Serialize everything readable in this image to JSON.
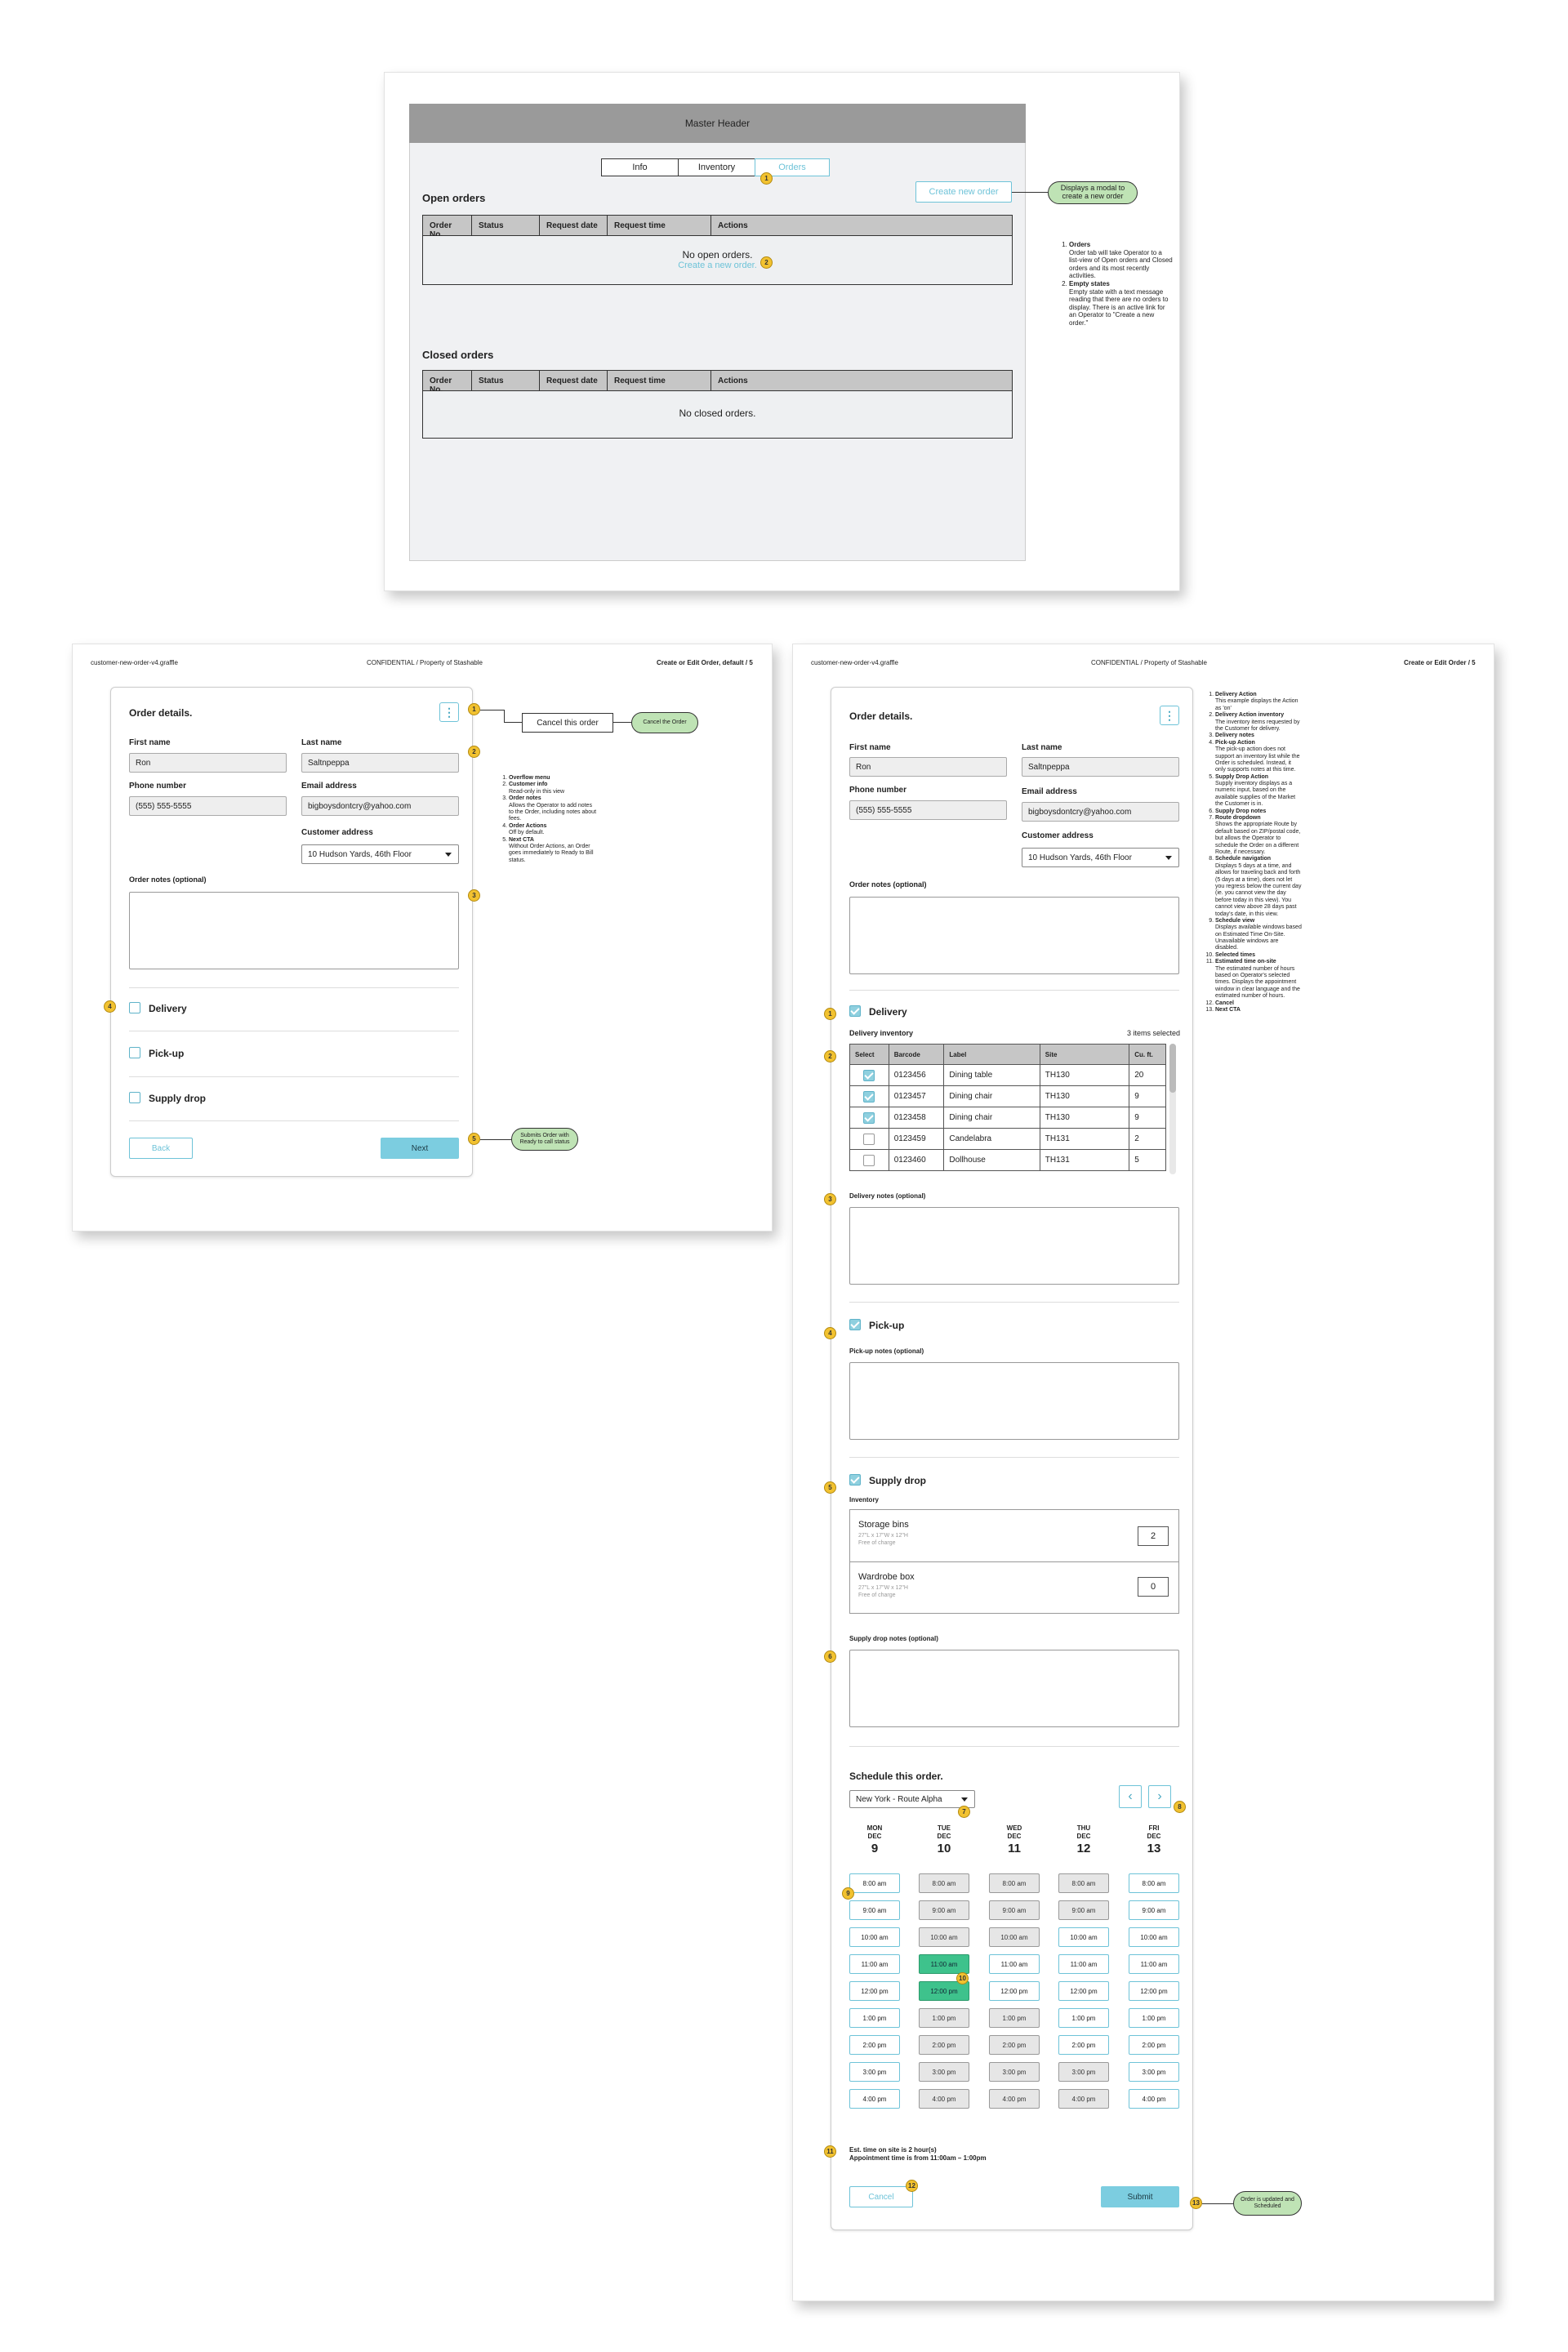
{
  "top_page": {
    "header": "Master Header",
    "tabs": [
      "Info",
      "Inventory",
      "Orders"
    ],
    "create_btn": "Create new order",
    "create_pill": "Displays a modal to create a new order",
    "open_title": "Open orders",
    "closed_title": "Closed orders",
    "cols": [
      "Order No.",
      "Status",
      "Request date",
      "Request time",
      "Actions"
    ],
    "open_empty": "No open orders.",
    "open_link": "Create a new order.",
    "closed_empty": "No closed orders.",
    "notes": [
      {
        "title": "Orders",
        "text": "Order tab will take Operator to a list-view of Open orders and Closed orders and its most recently activities."
      },
      {
        "title": "Empty states",
        "text": "Empty state with a text message reading that there are no orders to display. There is an active link for an Operator to \"Create a new order.\""
      }
    ]
  },
  "left_page": {
    "file": "customer-new-order-v4.graffle",
    "confidential": "CONFIDENTIAL",
    "property": "Property of Stashable",
    "page_label": "Create or Edit Order, default",
    "page_num": "5",
    "form": {
      "title": "Order details.",
      "first_name_label": "First name",
      "first_name": "Ron",
      "last_name_label": "Last name",
      "last_name": "Saltnpeppa",
      "phone_label": "Phone number",
      "phone": "(555) 555-5555",
      "email_label": "Email address",
      "email": "bigboysdontcry@yahoo.com",
      "address_label": "Customer address",
      "address": "10 Hudson Yards, 46th Floor",
      "notes_label": "Order notes (optional)",
      "delivery": "Delivery",
      "pickup": "Pick-up",
      "supply": "Supply drop",
      "back": "Back",
      "next": "Next"
    },
    "cancel_btn": "Cancel this order",
    "cancel_pill": "Cancel the Order",
    "submit_pill": "Submits Order with Ready to call status",
    "notes": [
      {
        "title": "Overflow menu",
        "text": ""
      },
      {
        "title": "Customer info",
        "text": "Read-only in this view"
      },
      {
        "title": "Order notes",
        "text": "Allows the Operator to add notes to the Order, including notes about fees."
      },
      {
        "title": "Order Actions",
        "text": "Off by default."
      },
      {
        "title": "Next CTA",
        "text": "Without Order Actions, an Order goes immediately to Ready to Bill status."
      }
    ]
  },
  "right_page": {
    "file": "customer-new-order-v4.graffle",
    "confidential": "CONFIDENTIAL",
    "property": "Property of Stashable",
    "page_label": "Create or Edit Order",
    "page_num": "5",
    "form": {
      "title": "Order details.",
      "first_name_label": "First name",
      "first_name": "Ron",
      "last_name_label": "Last name",
      "last_name": "Saltnpeppa",
      "phone_label": "Phone number",
      "phone": "(555) 555-5555",
      "email_label": "Email address",
      "email": "bigboysdontcry@yahoo.com",
      "address_label": "Customer address",
      "address": "10 Hudson Yards, 46th Floor",
      "notes_label": "Order notes (optional)",
      "delivery": "Delivery",
      "delivery_inv_label": "Delivery inventory",
      "items_selected": "3 items selected",
      "inv_cols": [
        "Select",
        "Barcode",
        "Label",
        "Site",
        "Cu. ft."
      ],
      "inv_rows": [
        {
          "checked": true,
          "barcode": "0123456",
          "label": "Dining table",
          "site": "TH130",
          "cuft": "20"
        },
        {
          "checked": true,
          "barcode": "0123457",
          "label": "Dining chair",
          "site": "TH130",
          "cuft": "9"
        },
        {
          "checked": true,
          "barcode": "0123458",
          "label": "Dining chair",
          "site": "TH130",
          "cuft": "9"
        },
        {
          "checked": false,
          "barcode": "0123459",
          "label": "Candelabra",
          "site": "TH131",
          "cuft": "2"
        },
        {
          "checked": false,
          "barcode": "0123460",
          "label": "Dollhouse",
          "site": "TH131",
          "cuft": "5"
        }
      ],
      "delivery_notes_label": "Delivery notes (optional)",
      "pickup": "Pick-up",
      "pickup_notes_label": "Pick-up notes (optional)",
      "supply": "Supply drop",
      "inventory_label": "Inventory",
      "supplies": [
        {
          "name": "Storage bins",
          "dims": "27\"L x 17\"W x 12\"H",
          "price": "Free of charge",
          "qty": "2"
        },
        {
          "name": "Wardrobe box",
          "dims": "27\"L x 17\"W x 12\"H",
          "price": "Free of charge",
          "qty": "0"
        }
      ],
      "supply_notes_label": "Supply drop notes (optional)",
      "schedule_title": "Schedule this order.",
      "route": "New York - Route Alpha",
      "days": [
        {
          "dow": "MON",
          "mon": "DEC",
          "num": "9"
        },
        {
          "dow": "TUE",
          "mon": "DEC",
          "num": "10"
        },
        {
          "dow": "WED",
          "mon": "DEC",
          "num": "11"
        },
        {
          "dow": "THU",
          "mon": "DEC",
          "num": "12"
        },
        {
          "dow": "FRI",
          "mon": "DEC",
          "num": "13"
        }
      ],
      "times": [
        "8:00 am",
        "9:00 am",
        "10:00 am",
        "11:00 am",
        "12:00 pm",
        "1:00 pm",
        "2:00 pm",
        "3:00 pm",
        "4:00 pm"
      ],
      "est_line1": "Est. time on site is 2 hour(s)",
      "est_line2": "Appointment time is from 11:00am – 1:00pm",
      "cancel": "Cancel",
      "submit": "Submit"
    },
    "submit_pill": "Order is updated and Scheduled",
    "notes": [
      {
        "title": "Delivery Action",
        "text": "This example displays the Action as 'on'"
      },
      {
        "title": "Delivery Action inventory",
        "text": "The inventory items requested by the Customer for delivery."
      },
      {
        "title": "Delivery notes",
        "text": ""
      },
      {
        "title": "Pick-up Action",
        "text": "The pick-up action does not support an inventory list while the Order is scheduled. Instead, it only supports notes at this time."
      },
      {
        "title": "Supply Drop Action",
        "text": "Supply inventory displays as a numeric input, based on the available supplies of the Market the Customer is in."
      },
      {
        "title": "Supply Drop notes",
        "text": ""
      },
      {
        "title": "Route dropdown",
        "text": "Shows the appropriate Route by default based on ZIP/postal code, but allows the Operator to schedule the Order on a different Route, if necessary."
      },
      {
        "title": "Schedule navigation",
        "text": "Displays 5 days at a time, and allows for traveling back and forth (5 days at a time), does not let you regress below the current day (ie. you cannot view the day before today in this view). You cannot view above 28 days past today's date, in this view."
      },
      {
        "title": "Schedule view",
        "text": "Displays available windows based on Estimated Time On-Site. Unavailable windows are disabled."
      },
      {
        "title": "Selected times",
        "text": ""
      },
      {
        "title": "Estimated time on-site",
        "text": "The estimated number of hours based on Operator's selected times. Displays the appointment window in clear language and the estimated number of hours."
      },
      {
        "title": "Cancel",
        "text": ""
      },
      {
        "title": "Next CTA",
        "text": ""
      }
    ]
  },
  "colors": {
    "accent": "#6ec3d8",
    "selected": "#3ec28c",
    "marker": "#f2c230",
    "pill": "#bfe3b5"
  }
}
